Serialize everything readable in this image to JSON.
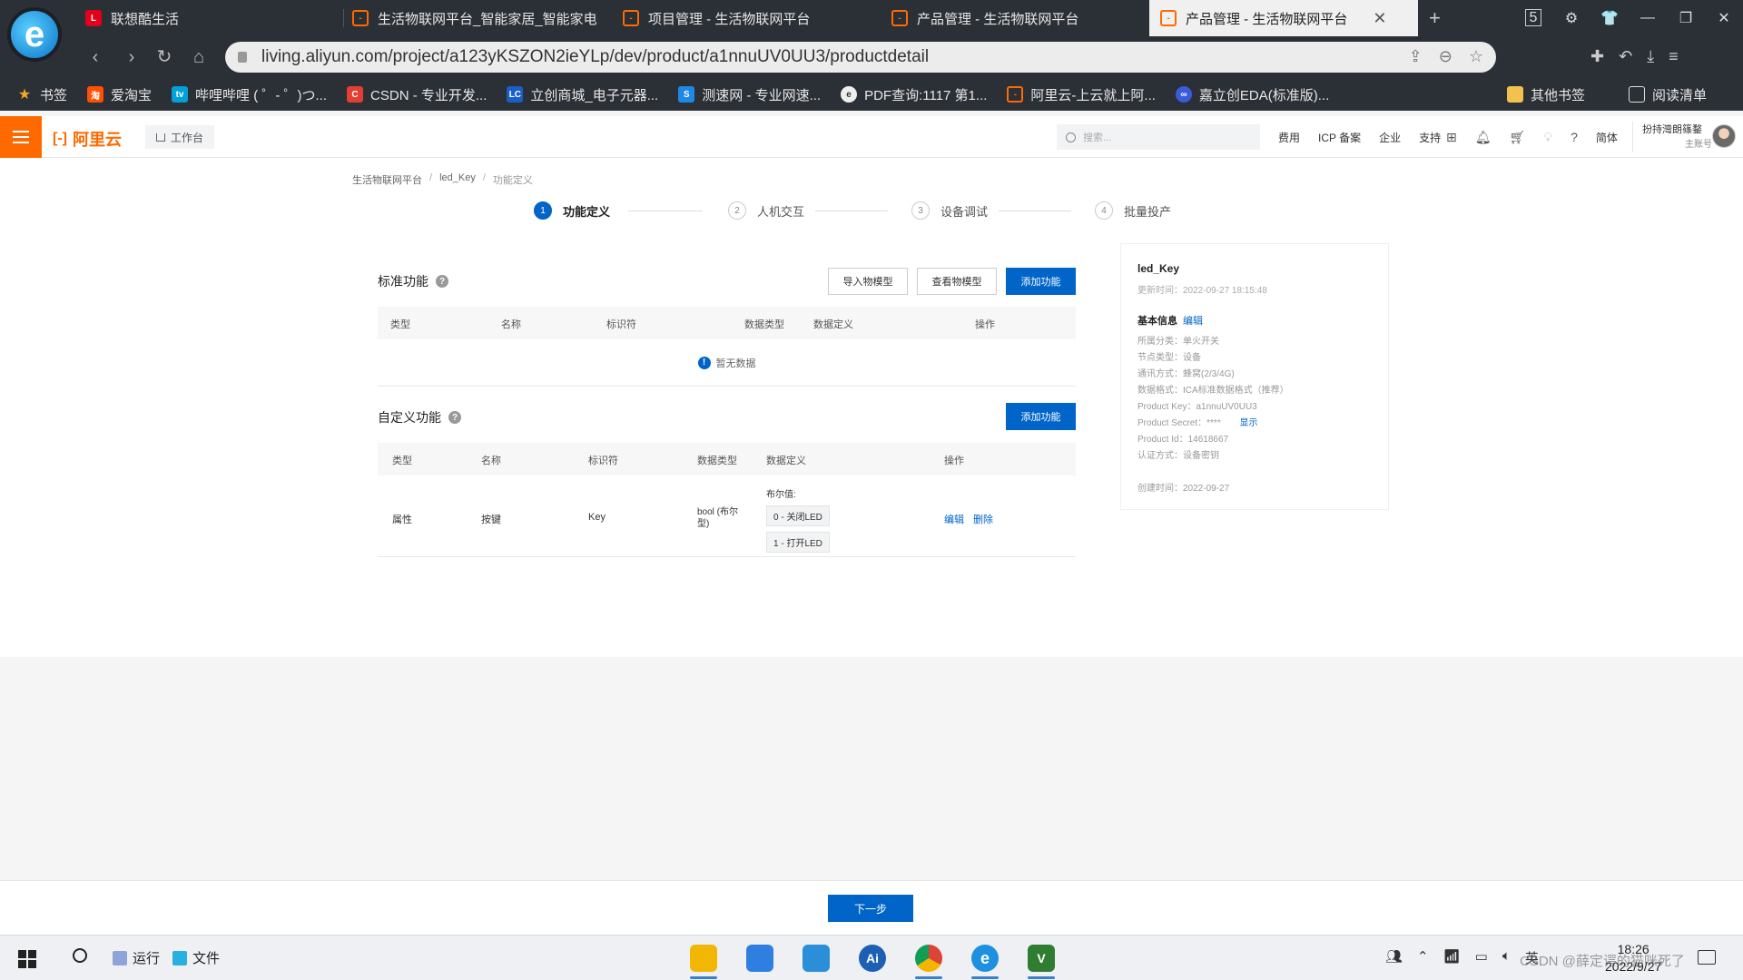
{
  "browser": {
    "tabs": [
      {
        "title": "联想酷生活",
        "icon": "lenovo-icon",
        "color": "#e2001a"
      },
      {
        "title": "生活物联网平台_智能家居_智能家电",
        "icon": "aliyun-icon",
        "color": "#ff6a00"
      },
      {
        "title": "项目管理 - 生活物联网平台",
        "icon": "aliyun-icon",
        "color": "#ff6a00"
      },
      {
        "title": "产品管理 - 生活物联网平台",
        "icon": "aliyun-icon",
        "color": "#ff6a00"
      },
      {
        "title": "产品管理 - 生活物联网平台",
        "icon": "aliyun-icon",
        "color": "#ff6a00"
      }
    ],
    "new_tab": "+",
    "tab_count_badge": "5",
    "url": "living.aliyun.com/project/a123yKSZON2ieYLp/dev/product/a1nnuUV0UU3/productdetail",
    "bookmarks": [
      {
        "label": "书签",
        "icon": "star-icon",
        "color": "#f5a623"
      },
      {
        "label": "爱淘宝",
        "icon": "taobao-icon",
        "color": "#ff5000"
      },
      {
        "label": "哔哩哔哩 ( ゜- ゜)つ...",
        "icon": "bilibili-icon",
        "color": "#00a1d6"
      },
      {
        "label": "CSDN - 专业开发...",
        "icon": "csdn-icon",
        "color": "#e33e33"
      },
      {
        "label": "立创商城_电子元器...",
        "icon": "lcsc-icon",
        "color": "#1a5fc8"
      },
      {
        "label": "测速网 - 专业网速...",
        "icon": "speedtest-icon",
        "color": "#1e88e5"
      },
      {
        "label": "PDF查询:1117 第1...",
        "icon": "pdf-icon",
        "color": "#555555"
      },
      {
        "label": "阿里云-上云就上阿...",
        "icon": "aliyun-icon",
        "color": "#ff6a00"
      },
      {
        "label": "嘉立创EDA(标准版)...",
        "icon": "eda-icon",
        "color": "#3b5bdb"
      }
    ],
    "bookmarks_right": [
      {
        "label": "其他书签",
        "icon": "folder-icon"
      },
      {
        "label": "阅读清单",
        "icon": "reading-list-icon"
      }
    ]
  },
  "header": {
    "logo": "阿里云",
    "logo_bracket": "[-]",
    "workbench": "工作台",
    "search_placeholder": "搜索...",
    "links": [
      "费用",
      "ICP 备案",
      "企业",
      "支持"
    ],
    "lang": "简体",
    "user_name": "扮持灣朗篠鍪",
    "user_role": "主账号",
    "accent": "#ff6a00"
  },
  "breadcrumb": [
    "生活物联网平台",
    "led_Key",
    "功能定义"
  ],
  "steps": [
    {
      "num": "1",
      "label": "功能定义",
      "active": true
    },
    {
      "num": "2",
      "label": "人机交互",
      "active": false
    },
    {
      "num": "3",
      "label": "设备调试",
      "active": false
    },
    {
      "num": "4",
      "label": "批量投产",
      "active": false
    }
  ],
  "standard": {
    "title": "标准功能",
    "help": "?",
    "buttons": {
      "import": "导入物模型",
      "view": "查看物模型",
      "add": "添加功能"
    },
    "columns": [
      "类型",
      "名称",
      "标识符",
      "数据类型",
      "数据定义",
      "操作"
    ],
    "empty_icon": "!",
    "empty_text": "暂无数据"
  },
  "custom": {
    "title": "自定义功能",
    "help": "?",
    "add_button": "添加功能",
    "columns": [
      "类型",
      "名称",
      "标识符",
      "数据类型",
      "数据定义",
      "操作"
    ],
    "rows": [
      {
        "type": "属性",
        "name": "按键",
        "identifier": "Key",
        "datatype": "bool (布尔型)",
        "def_label": "布尔值:",
        "def_values": [
          "0 - 关闭LED",
          "1 - 打开LED"
        ],
        "actions": [
          "编辑",
          "删除"
        ]
      }
    ]
  },
  "product": {
    "name": "led_Key",
    "updated": "更新时间：2022-09-27 18:15:48",
    "basic_title": "基本信息",
    "edit": "编辑",
    "fields": [
      "所属分类：单火开关",
      "节点类型：设备",
      "通讯方式：蜂窝(2/3/4G)",
      "数据格式：ICA标准数据格式（推荐）",
      "Product Key：a1nnuUV0UU3",
      "Product Secret：****",
      "Product Id：14618667",
      "认证方式：设备密钥"
    ],
    "show_secret": "显示",
    "created": "创建时间：2022-09-27"
  },
  "footer": {
    "next_button": "下一步"
  },
  "taskbar": {
    "run": "运行",
    "files": "文件",
    "apps": [
      {
        "icon": "file-explorer-icon",
        "color": "#f2b705",
        "label": ""
      },
      {
        "icon": "flame-icon",
        "color": "#2f7fe0",
        "label": ""
      },
      {
        "icon": "box-icon",
        "color": "#2a8fd8",
        "label": ""
      },
      {
        "icon": "ai-icon",
        "color": "#1c5fb3",
        "label": "Ai"
      },
      {
        "icon": "chrome-icon",
        "color": "#db4437",
        "label": ""
      },
      {
        "icon": "browser-e-icon",
        "color": "#1e90e0",
        "label": "e"
      },
      {
        "icon": "v-app-icon",
        "color": "#2e7d32",
        "label": "V"
      }
    ],
    "tray_lang": "英",
    "time": "18:26",
    "date": "2022/9/27",
    "watermark": "CSDN @薛定谔的猫咪死了"
  }
}
